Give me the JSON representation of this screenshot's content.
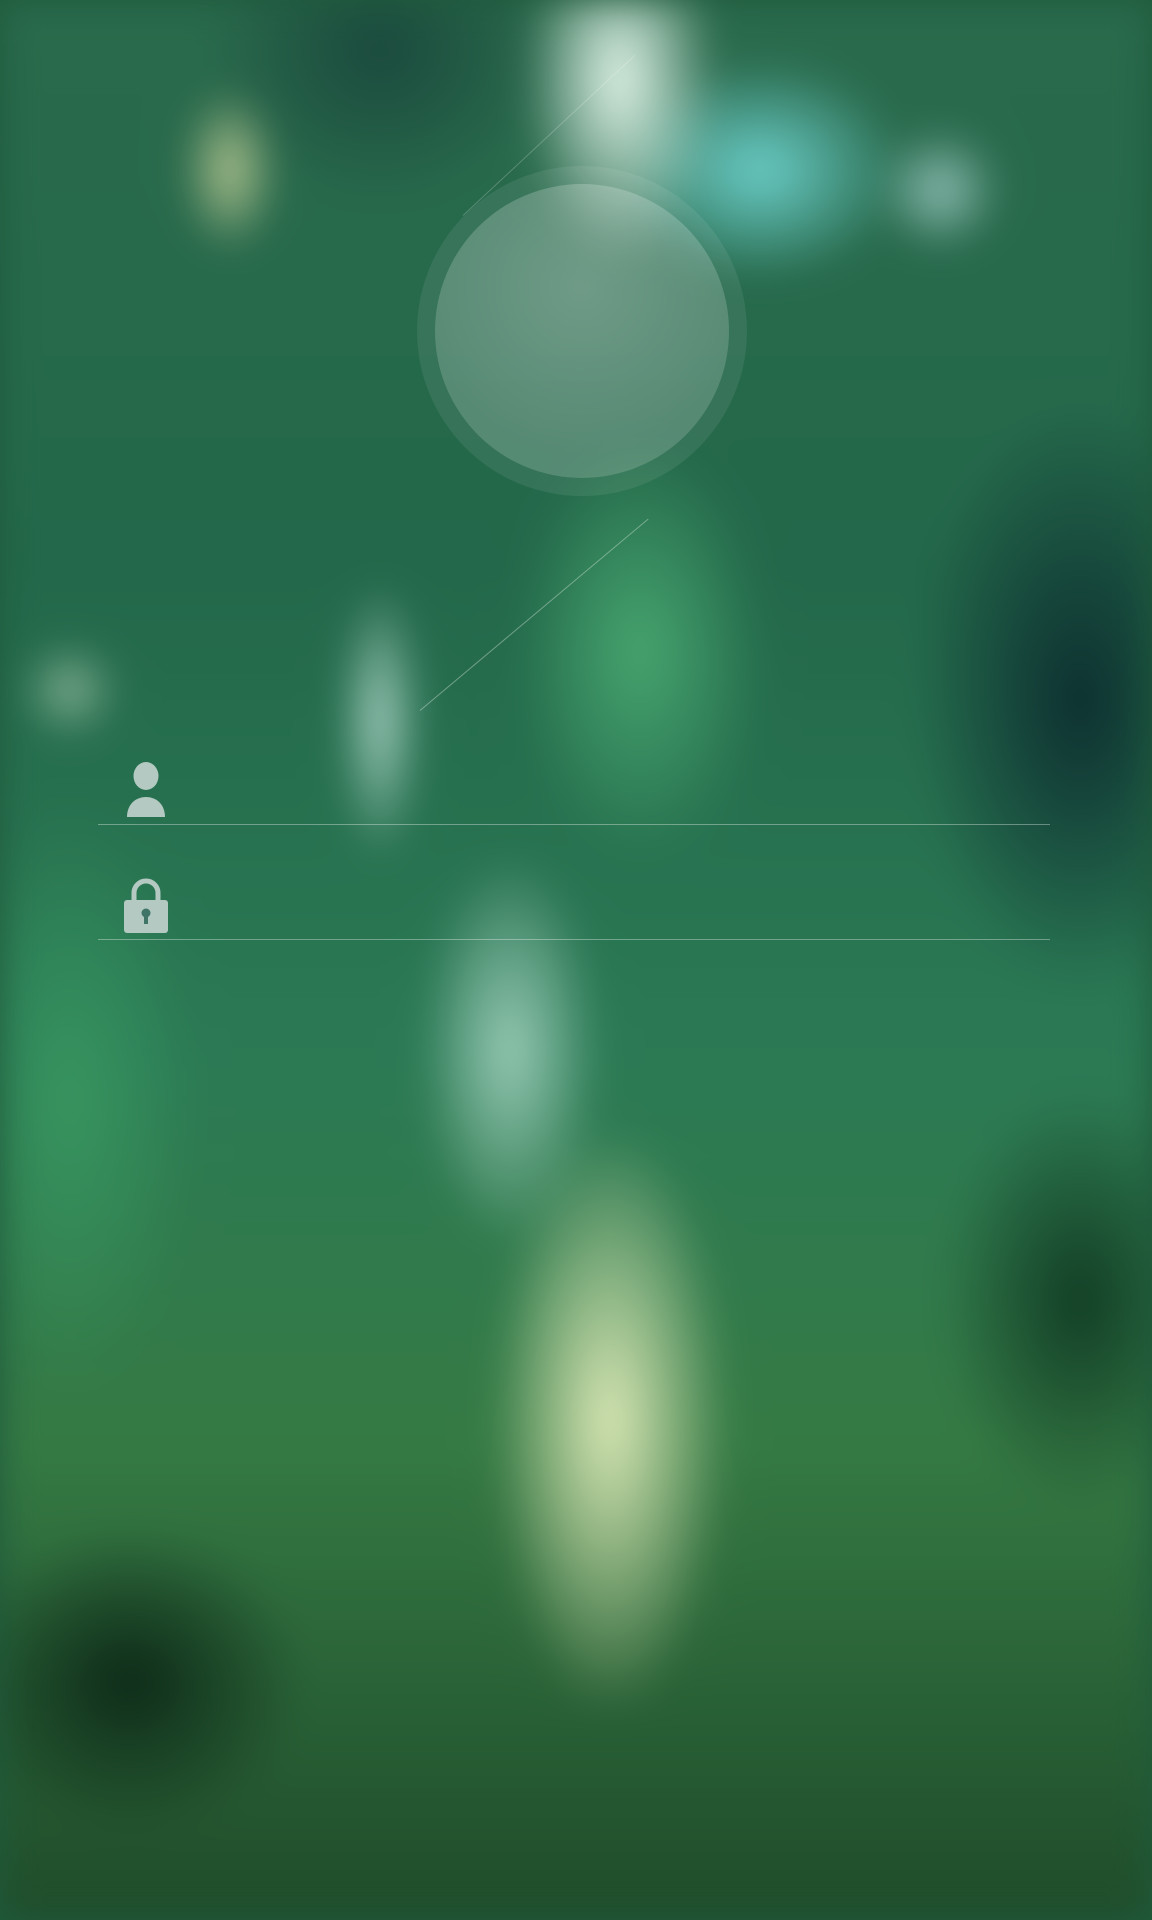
{
  "login_form": {
    "username": {
      "icon": "user-icon",
      "value": "",
      "placeholder": ""
    },
    "password": {
      "icon": "lock-icon",
      "value": "",
      "placeholder": ""
    }
  },
  "colors": {
    "icon_fill": "#b3c9c2",
    "divider": "rgba(255,255,255,0.35)"
  }
}
